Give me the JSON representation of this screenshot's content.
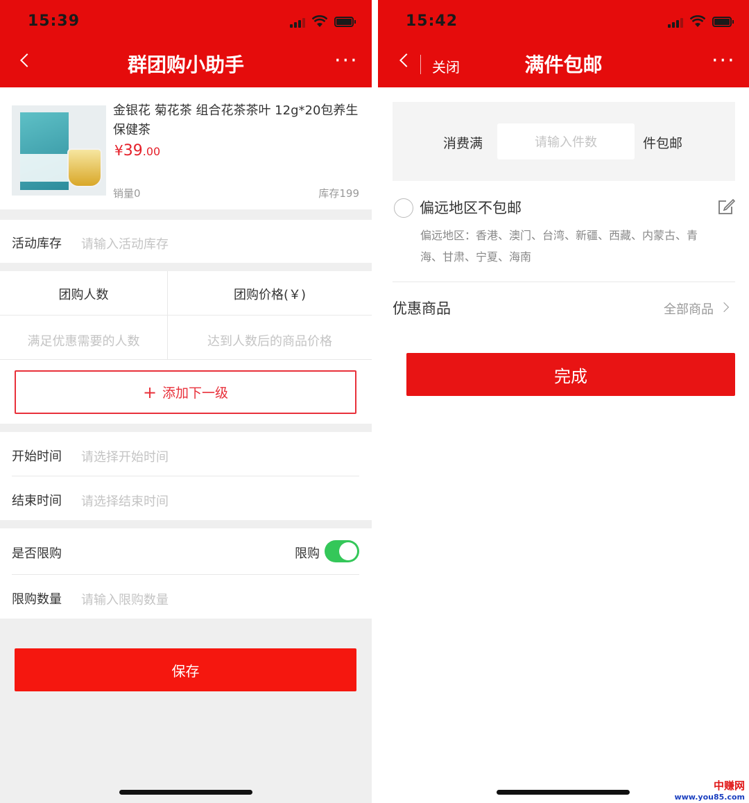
{
  "left": {
    "status": {
      "time": "15:39"
    },
    "header": {
      "title": "群团购小助手",
      "more": "···"
    },
    "product": {
      "name": "金银花 菊花茶 组合花茶茶叶 12g*20包养生保健茶",
      "price_symbol": "¥",
      "price_int": "39",
      "price_dec": ".00",
      "sales": "销量0",
      "stock": "库存199"
    },
    "activity_stock": {
      "label": "活动库存",
      "placeholder": "请输入活动库存"
    },
    "tiers": {
      "col1_header": "团购人数",
      "col2_header": "团购价格(￥)",
      "col1_placeholder": "满足优惠需要的人数",
      "col2_placeholder": "达到人数后的商品价格"
    },
    "add_tier": {
      "plus": "+",
      "label": "添加下一级"
    },
    "start_time": {
      "label": "开始时间",
      "placeholder": "请选择开始时间"
    },
    "end_time": {
      "label": "结束时间",
      "placeholder": "请选择结束时间"
    },
    "limit": {
      "label": "是否限购",
      "toggle_label": "限购",
      "enabled": true
    },
    "limit_qty": {
      "label": "限购数量",
      "placeholder": "请输入限购数量"
    },
    "save_label": "保存"
  },
  "right": {
    "status": {
      "time": "15:42"
    },
    "header": {
      "close": "关闭",
      "title": "满件包邮",
      "more": "···"
    },
    "rule": {
      "prefix": "消费满",
      "placeholder": "请输入件数",
      "suffix": "件包邮"
    },
    "remote": {
      "label": "偏远地区不包邮",
      "detail_line1": "偏远地区：香港、澳门、台湾、新疆、西藏、内蒙古、青",
      "detail_line2": "海、甘肃、宁夏、海南"
    },
    "discount_goods": {
      "label": "优惠商品",
      "value": "全部商品"
    },
    "done_label": "完成"
  },
  "watermark": {
    "line1": "中赚网",
    "line2": "www.you85.com"
  },
  "colors": {
    "brand_red": "#e50c0c",
    "button_red": "#f5170f",
    "toggle_green": "#34c759"
  }
}
